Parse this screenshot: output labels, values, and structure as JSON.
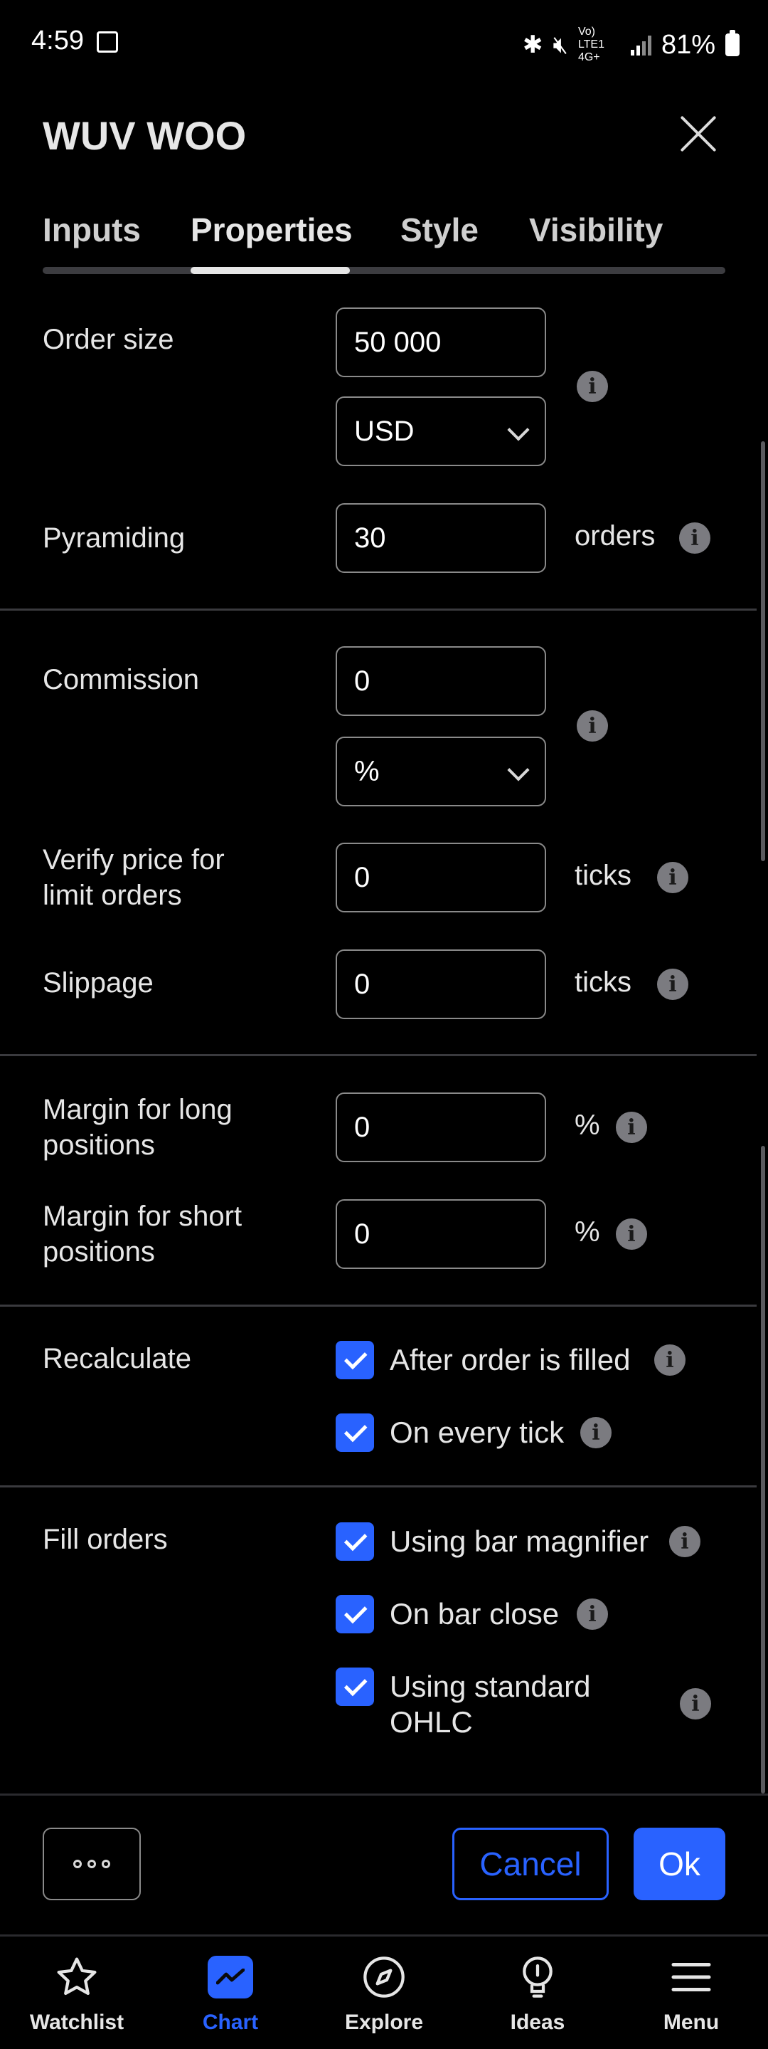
{
  "status_bar": {
    "time": "4:59",
    "battery": "81%",
    "network": "Vo) LTE1 4G+"
  },
  "header": {
    "title": "WUV WOO"
  },
  "tabs": [
    {
      "label": "Inputs"
    },
    {
      "label": "Properties",
      "active": true
    },
    {
      "label": "Style"
    },
    {
      "label": "Visibility"
    }
  ],
  "form": {
    "order_size": {
      "label": "Order size",
      "value": "50 000",
      "currency": "USD"
    },
    "pyramiding": {
      "label": "Pyramiding",
      "value": "30",
      "unit": "orders"
    },
    "commission": {
      "label": "Commission",
      "value": "0",
      "type": "%"
    },
    "verify_price": {
      "label_line1": "Verify price for",
      "label_line2": "limit orders",
      "value": "0",
      "unit": "ticks"
    },
    "slippage": {
      "label": "Slippage",
      "value": "0",
      "unit": "ticks"
    },
    "margin_long": {
      "label_line1": "Margin for long",
      "label_line2": "positions",
      "value": "0",
      "unit": "%"
    },
    "margin_short": {
      "label_line1": "Margin for short",
      "label_line2": "positions",
      "value": "0",
      "unit": "%"
    },
    "recalculate": {
      "label": "Recalculate",
      "options": [
        {
          "label": "After order is filled",
          "checked": true
        },
        {
          "label": "On every tick",
          "checked": true
        }
      ]
    },
    "fill_orders": {
      "label": "Fill orders",
      "options": [
        {
          "label": "Using bar magnifier",
          "checked": true
        },
        {
          "label": "On bar close",
          "checked": true
        },
        {
          "label_line1": "Using standard",
          "label_line2": "OHLC",
          "checked": true
        }
      ]
    },
    "info_glyph": "i"
  },
  "footer": {
    "cancel_label": "Cancel",
    "ok_label": "Ok"
  },
  "bottom_nav": [
    {
      "label": "Watchlist",
      "icon": "star-icon"
    },
    {
      "label": "Chart",
      "icon": "chart-icon",
      "active": true
    },
    {
      "label": "Explore",
      "icon": "compass-icon"
    },
    {
      "label": "Ideas",
      "icon": "lightbulb-icon"
    },
    {
      "label": "Menu",
      "icon": "menu-icon"
    }
  ],
  "colors": {
    "accent": "#2962ff",
    "background": "#000000",
    "text": "#e6e6e6"
  }
}
